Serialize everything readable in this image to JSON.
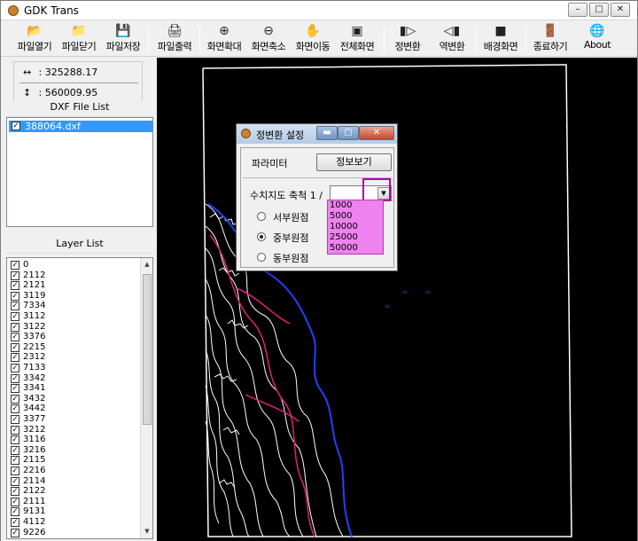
{
  "window": {
    "title": "GDK Trans",
    "controls": [
      "–",
      "□",
      "✕"
    ]
  },
  "toolbar": {
    "buttons": [
      {
        "id": "open",
        "label": "파일열기",
        "icon": "folder-open-icon"
      },
      {
        "id": "close",
        "label": "파일닫기",
        "icon": "folder-close-icon"
      },
      {
        "id": "save",
        "label": "파일저장",
        "icon": "save-icon"
      },
      {
        "id": "print",
        "label": "파일출력",
        "icon": "printer-icon"
      },
      {
        "id": "zoom_in",
        "label": "화면확대",
        "icon": "zoom-in-icon"
      },
      {
        "id": "zoom_out",
        "label": "화면축소",
        "icon": "zoom-out-icon"
      },
      {
        "id": "pan",
        "label": "화면이동",
        "icon": "hand-icon"
      },
      {
        "id": "full",
        "label": "전체화면",
        "icon": "full-screen-icon"
      },
      {
        "id": "forward",
        "label": "정변환",
        "icon": "forward-transform-icon"
      },
      {
        "id": "inverse",
        "label": "역변환",
        "icon": "inverse-transform-icon"
      },
      {
        "id": "bg",
        "label": "배경화면",
        "icon": "background-icon"
      },
      {
        "id": "exit",
        "label": "종료하기",
        "icon": "exit-icon"
      },
      {
        "id": "about",
        "label": "About",
        "icon": "about-icon"
      }
    ]
  },
  "coords": {
    "x": "325288.17",
    "y": "560009.95",
    "x_sep": ":",
    "y_sep": ":"
  },
  "dxf": {
    "header": "DXF File List",
    "files": [
      {
        "name": "388064.dxf",
        "checked": true,
        "selected": true
      }
    ]
  },
  "layers": {
    "header": "Layer List",
    "items": [
      "0",
      "2112",
      "2121",
      "3119",
      "7334",
      "3112",
      "3122",
      "3376",
      "2215",
      "2312",
      "7133",
      "3342",
      "3341",
      "3432",
      "3442",
      "3377",
      "3212",
      "3116",
      "3216",
      "2115",
      "2216",
      "2114",
      "2122",
      "2111",
      "9131",
      "4112",
      "9226"
    ]
  },
  "dialog": {
    "title": "정변환 설정",
    "param_label": "파라미터",
    "info_button": "정보보기",
    "scale_label": "수치지도 축척 1 /",
    "scale_value": "",
    "scale_options": [
      "1000",
      "5000",
      "10000",
      "25000",
      "50000"
    ],
    "origins": [
      {
        "label": "서부원점",
        "selected": false
      },
      {
        "label": "중부원점",
        "selected": true
      },
      {
        "label": "동부원점",
        "selected": false
      }
    ]
  },
  "colors": {
    "canvas_bg": "#000000",
    "selection": "#3399ff",
    "dropdown_highlight": "#ee82ee",
    "highlight_border": "#b000b0"
  }
}
